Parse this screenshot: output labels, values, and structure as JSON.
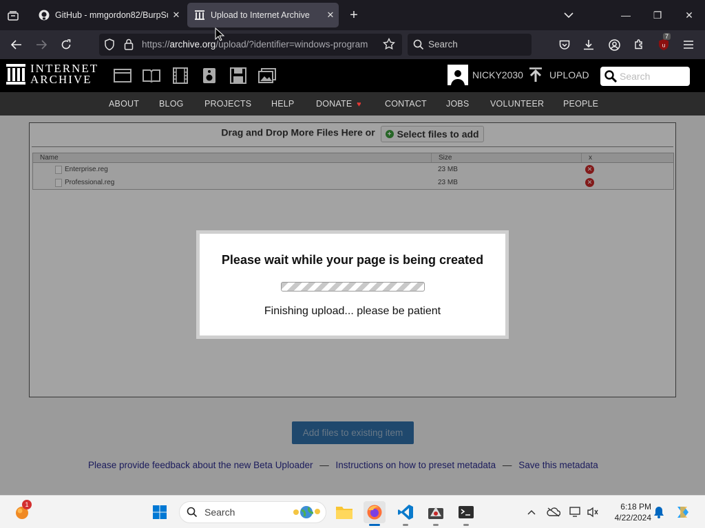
{
  "browser": {
    "tabs": [
      {
        "title": "GitHub - mmgordon82/BurpSu",
        "active": false
      },
      {
        "title": "Upload to Internet Archive",
        "active": true
      }
    ],
    "url": {
      "prefix": "https://",
      "host": "archive.org",
      "path": "/upload/?identifier=windows-program"
    },
    "search_placeholder": "Search",
    "extension_badge": "7"
  },
  "archive": {
    "logo_line1": "INTERNET",
    "logo_line2": "ARCHIVE",
    "username": "NICKY2030",
    "upload_label": "UPLOAD",
    "search_placeholder": "Search",
    "menu": [
      "ABOUT",
      "BLOG",
      "PROJECTS",
      "HELP",
      "DONATE",
      "CONTACT",
      "JOBS",
      "VOLUNTEER",
      "PEOPLE"
    ]
  },
  "uploader": {
    "drop_text": "Drag and Drop More Files Here or",
    "select_button": "Select files to add",
    "columns": {
      "name": "Name",
      "size": "Size",
      "remove": "x"
    },
    "files": [
      {
        "name": "Enterprise.reg",
        "size": "23 MB"
      },
      {
        "name": "Professional.reg",
        "size": "23 MB"
      }
    ],
    "add_existing_button": "Add files to existing item",
    "links": [
      "Please provide feedback about the new Beta Uploader",
      "Instructions on how to preset metadata",
      "Save this metadata"
    ],
    "link_separator": "—"
  },
  "dialog": {
    "title": "Please wait while your page is being created",
    "status": "Finishing upload... please be patient"
  },
  "taskbar": {
    "search_placeholder": "Search",
    "time": "6:18 PM",
    "date": "4/22/2024",
    "notification_badge": "1"
  },
  "colors": {
    "browser_bg": "#1c1b22",
    "active_tab": "#42414d",
    "archive_header": "#000000",
    "archive_menu": "#2c2c2c",
    "primary_button": "#2f6ea6",
    "link": "#2b2b8c",
    "remove": "#c62828"
  }
}
